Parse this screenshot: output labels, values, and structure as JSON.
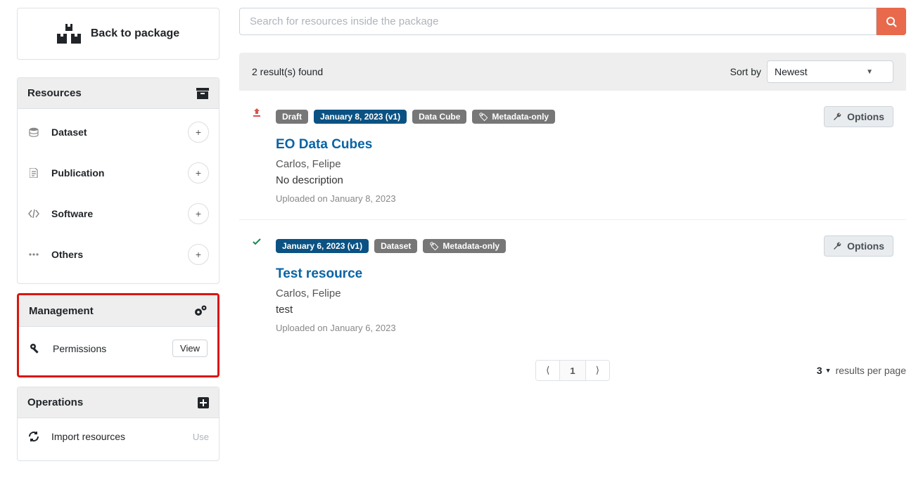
{
  "back": {
    "label": "Back to package"
  },
  "sidebar": {
    "resources": {
      "title": "Resources",
      "items": [
        {
          "label": "Dataset"
        },
        {
          "label": "Publication"
        },
        {
          "label": "Software"
        },
        {
          "label": "Others"
        }
      ]
    },
    "management": {
      "title": "Management",
      "items": [
        {
          "label": "Permissions",
          "action": "View"
        }
      ]
    },
    "operations": {
      "title": "Operations",
      "items": [
        {
          "label": "Import resources",
          "action": "Use"
        }
      ]
    }
  },
  "search": {
    "placeholder": "Search for resources inside the package"
  },
  "results": {
    "count_text": "2 result(s) found",
    "sort_label": "Sort by",
    "sort_value": "Newest"
  },
  "resources": [
    {
      "status": "upload",
      "tags": [
        "Draft",
        "January 8, 2023 (v1)",
        "Data Cube",
        "Metadata-only"
      ],
      "title": "EO Data Cubes",
      "author": "Carlos, Felipe",
      "description": "No description",
      "uploaded": "Uploaded on January 8, 2023"
    },
    {
      "status": "check",
      "tags": [
        "January 6, 2023 (v1)",
        "Dataset",
        "Metadata-only"
      ],
      "title": "Test resource",
      "author": "Carlos, Felipe",
      "description": "test",
      "uploaded": "Uploaded on January 6, 2023"
    }
  ],
  "options_label": "Options",
  "pager": {
    "prev": "⟨",
    "page": "1",
    "next": "⟩"
  },
  "rpp": {
    "value": "3",
    "label": "results per page"
  }
}
